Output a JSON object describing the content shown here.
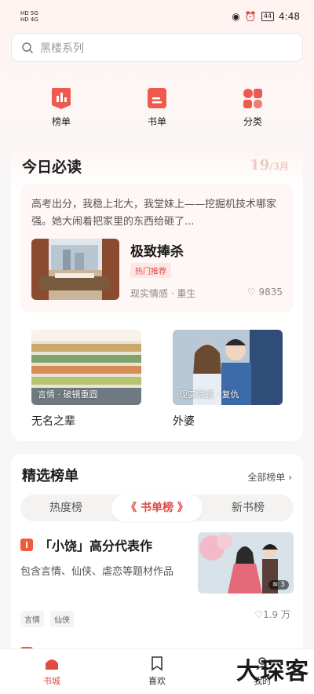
{
  "status": {
    "left_line1": "HD 5G",
    "left_line2": "HD 4G",
    "time": "4:48",
    "battery": "44"
  },
  "search": {
    "placeholder": "黑楼系列"
  },
  "quick": [
    {
      "label": "榜单",
      "icon": "chart-icon"
    },
    {
      "label": "书单",
      "icon": "booklist-icon"
    },
    {
      "label": "分类",
      "icon": "category-icon"
    }
  ],
  "today": {
    "title": "今日必读",
    "date_day": "19",
    "date_month": "/3月",
    "feature": {
      "blurb": "高考出分，我稳上北大，我堂妹上——挖掘机技术哪家强。她大闹着把家里的东西给砸了...",
      "title": "极致捧杀",
      "tag": "热门推荐",
      "meta": "现实情感 · 重生",
      "likes": "9835"
    },
    "books": [
      {
        "caption": "言情 · 破镜重圆",
        "name": "无名之辈"
      },
      {
        "caption": "现实情感 · 复仇",
        "name": "外婆"
      }
    ]
  },
  "rank": {
    "title": "精选榜单",
    "all": "全部榜单",
    "tabs": [
      "热度榜",
      "《 书单榜 》",
      "新书榜"
    ],
    "book": {
      "title": "「小饶」高分代表作",
      "desc": "包含言情、仙侠、虐恋等题材作品",
      "tags": [
        "言情",
        "仙侠"
      ],
      "count": "3",
      "likes": "1.9 万"
    }
  },
  "tabbar": [
    {
      "label": "书城",
      "icon": "home-icon"
    },
    {
      "label": "喜欢",
      "icon": "bookmark-icon"
    },
    {
      "label": "我的",
      "icon": "profile-icon"
    }
  ],
  "watermark": "大琛客",
  "colors": {
    "accent": "#e24b44",
    "tag_bg": "#fde7e5"
  }
}
